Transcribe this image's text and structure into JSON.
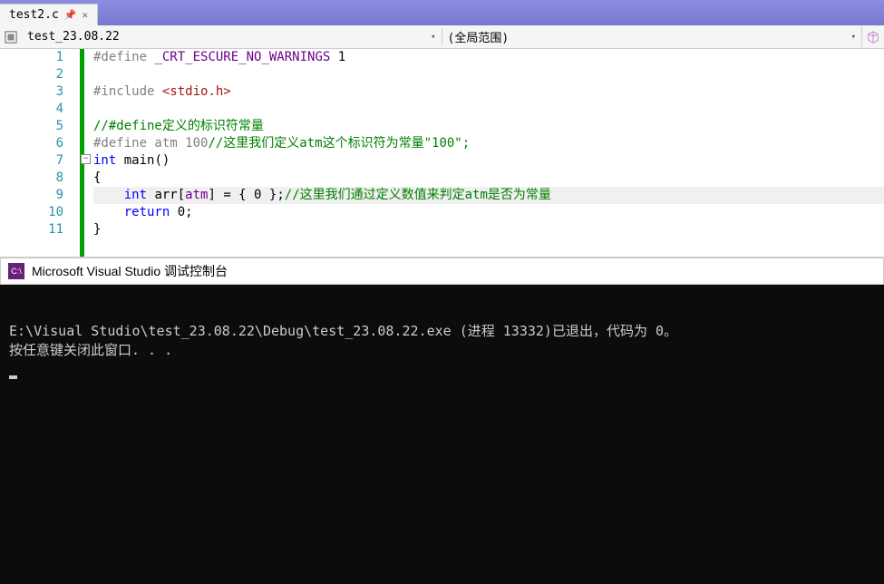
{
  "tab": {
    "name": "test2.c",
    "pin_glyph": "⟂",
    "close_glyph": "✕"
  },
  "nav": {
    "scope_left": "test_23.08.22",
    "scope_right": "(全局范围)"
  },
  "line_numbers": [
    "1",
    "2",
    "3",
    "4",
    "5",
    "6",
    "7",
    "8",
    "9",
    "10",
    "11"
  ],
  "code": {
    "l1_pp": "#define ",
    "l1_macro": "_CRT_ESCURE_NO_WARNINGS",
    "l1_val": " 1",
    "l3_pp": "#include ",
    "l3_hdr": "<stdio.h>",
    "l5_cmt": "//#define定义的标识符常量",
    "l6_pp": "#define atm 100",
    "l6_cmt": "//这里我们定义atm这个标识符为常量\"100\";",
    "l7_kw": "int",
    "l7_fn": " main()",
    "l8_brace": "{",
    "l9_indent": "    ",
    "l9_kw": "int",
    "l9_id1": " arr[",
    "l9_mac": "atm",
    "l9_id2": "] = { 0 };",
    "l9_cmt": "//这里我们通过定义数值来判定atm是否为常量",
    "l10_indent": "    ",
    "l10_kw": "return",
    "l10_val": " 0;",
    "l11_brace": "}"
  },
  "console": {
    "title": "Microsoft Visual Studio 调试控制台",
    "line1": "E:\\Visual Studio\\test_23.08.22\\Debug\\test_23.08.22.exe (进程 13332)已退出，代码为 0。",
    "line2": "按任意键关闭此窗口. . ."
  }
}
